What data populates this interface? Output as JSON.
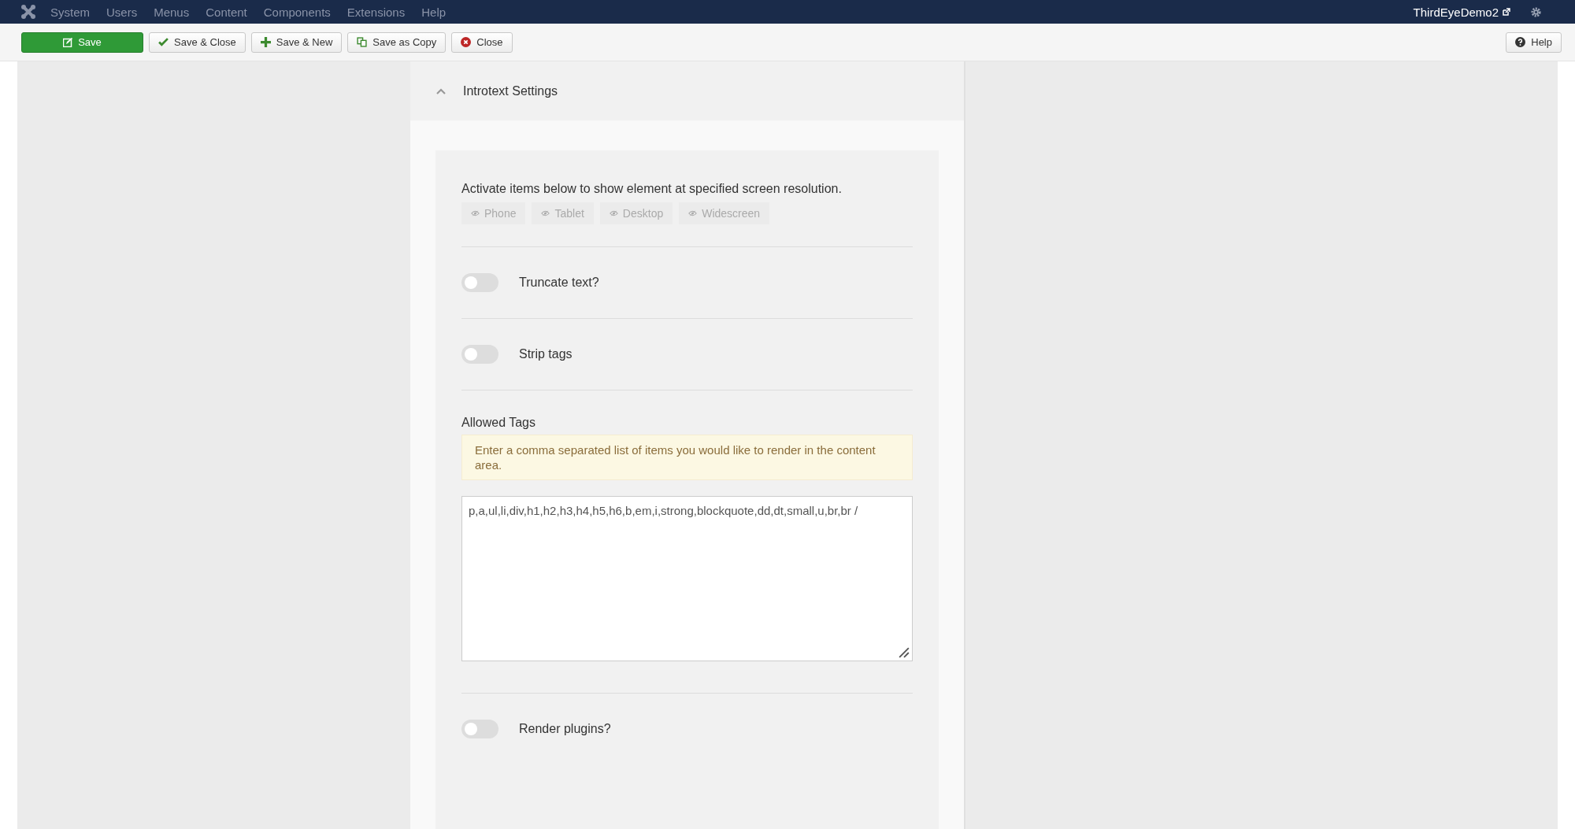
{
  "menu": [
    "System",
    "Users",
    "Menus",
    "Content",
    "Components",
    "Extensions",
    "Help"
  ],
  "user": "ThirdEyeDemo2",
  "toolbar": [
    {
      "label": "Save",
      "kind": "primary"
    },
    {
      "label": "Save & Close",
      "kind": "check"
    },
    {
      "label": "Save & New",
      "kind": "plus"
    },
    {
      "label": "Save as Copy",
      "kind": "copy"
    },
    {
      "label": "Close",
      "kind": "close"
    }
  ],
  "help_button": "Help",
  "panel": {
    "title": "Introtext Settings",
    "expanded": true,
    "visibility": {
      "text": "Activate items below to show element at specified screen resolution.",
      "devices": [
        {
          "label": "Phone",
          "selected": false
        },
        {
          "label": "Tablet",
          "selected": false
        },
        {
          "label": "Desktop",
          "selected": false
        },
        {
          "label": "Widescreen",
          "selected": false
        }
      ]
    },
    "fields": [
      {
        "kind": "toggle",
        "label": "Truncate text?",
        "on": false
      },
      {
        "kind": "toggle",
        "label": "Strip tags",
        "on": false
      },
      {
        "kind": "textarea",
        "label": "Allowed Tags",
        "hint": "Enter a comma separated list of items you would like to render in the content area.",
        "value": "p,a,ul,li,div,h1,h2,h3,h4,h5,h6,b,em,i,strong,blockquote,dd,dt,small,u,br,br /"
      },
      {
        "kind": "toggle",
        "label": "Render plugins?",
        "on": false
      }
    ]
  }
}
